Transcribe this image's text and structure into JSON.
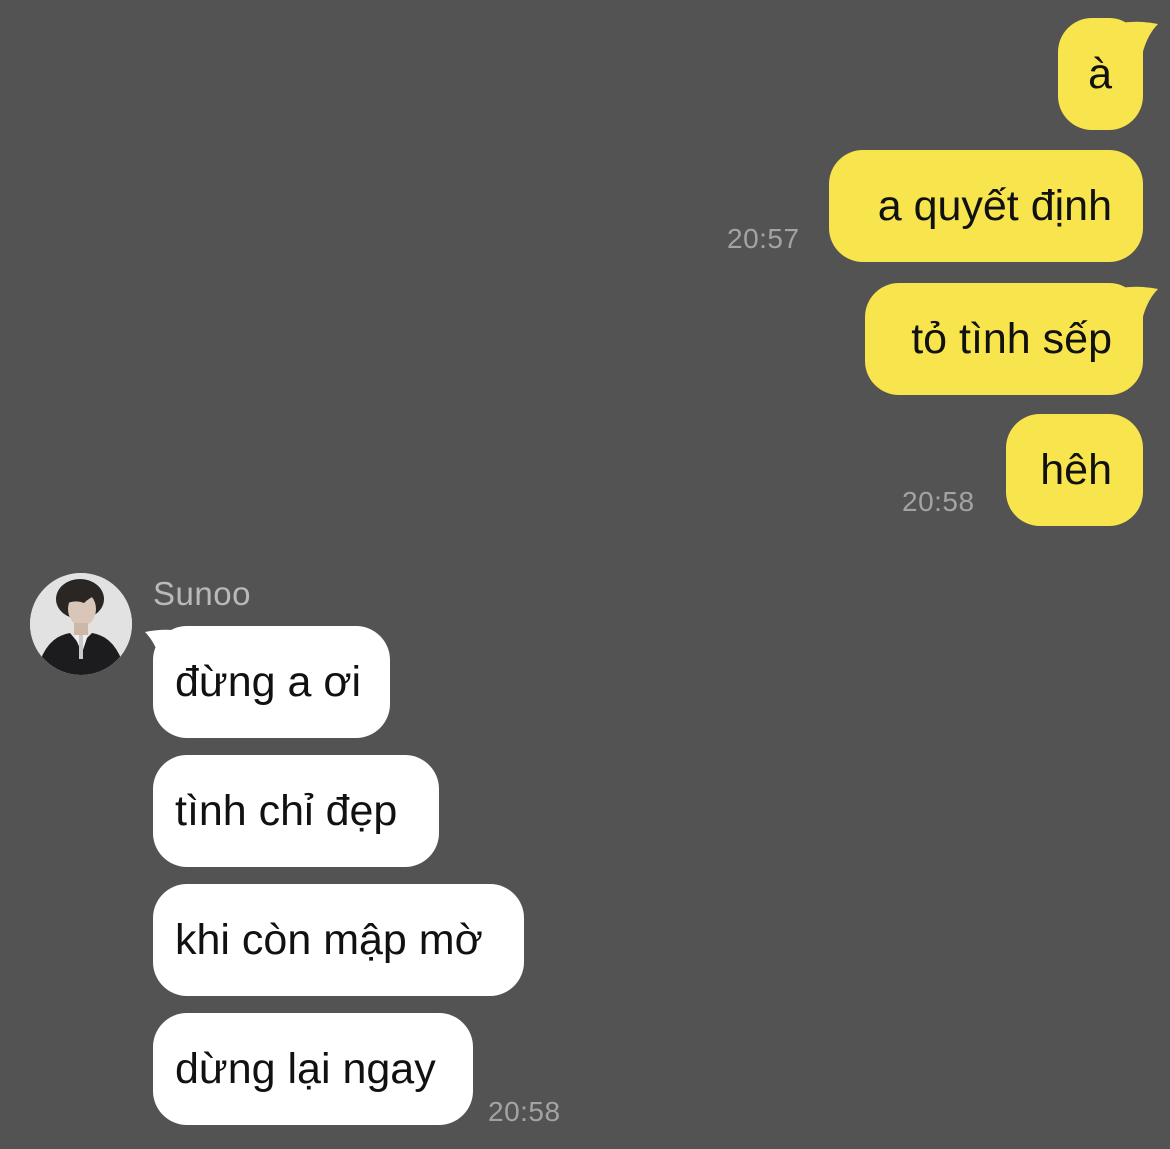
{
  "colors": {
    "background": "#545354",
    "sent_bubble": "#f8e44d",
    "received_bubble": "#ffffff",
    "timestamp": "#a3a3a3",
    "sender_name": "#b9b9b9"
  },
  "sent": [
    {
      "text": "à"
    },
    {
      "text": "a quyết định",
      "time": "20:57"
    },
    {
      "text": "tỏ tình sếp"
    },
    {
      "text": "hêh",
      "time": "20:58"
    }
  ],
  "received": {
    "sender": "Sunoo",
    "avatar_icon": "profile-photo",
    "messages": [
      {
        "text": "đừng a ơi"
      },
      {
        "text": "tình chỉ đẹp"
      },
      {
        "text": "khi còn mập mờ"
      },
      {
        "text": "dừng lại ngay",
        "time": "20:58"
      }
    ]
  }
}
